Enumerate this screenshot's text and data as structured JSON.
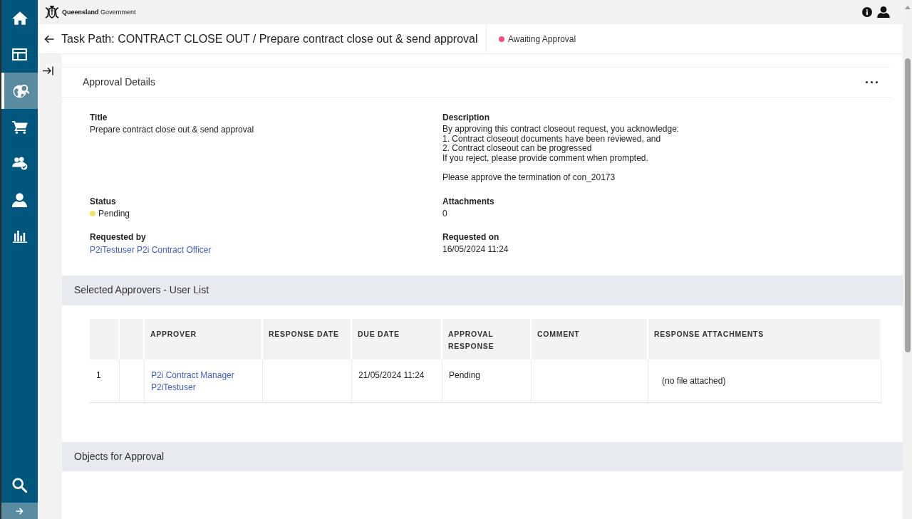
{
  "header": {
    "logo": "**Queensland** Government"
  },
  "sidebar": {
    "items": [
      {
        "selected": false
      },
      {
        "selected": false
      },
      {
        "selected": true
      },
      {
        "selected": false
      },
      {
        "selected": false
      },
      {
        "selected": false
      },
      {
        "selected": false
      }
    ]
  },
  "page_header": {
    "title": "Task Path: CONTRACT CLOSE OUT / Prepare contract close out & send approval",
    "status": {
      "label": "Awaiting Approval",
      "color": "#ee4f88"
    }
  },
  "approval_details": {
    "title": "Approval Details",
    "fields": [
      {
        "kind": "text",
        "label": "Title",
        "value": "Prepare contract close out & send approval"
      },
      {
        "kind": "paragraphs",
        "label": "Description",
        "paragraphs": [
          "By approving this contract closeout request, you acknowledge:\n1. Contract closeout documents have been reviewed, and\n2. Contract closeout can be progressed\nIf you reject, please provide comment when prompted.",
          "Please approve the termination of con_20173"
        ]
      },
      {
        "kind": "status",
        "label": "Status",
        "value": "Pending",
        "color": "#f3e36a"
      },
      {
        "kind": "text",
        "label": "Attachments",
        "value": "0"
      },
      {
        "kind": "link",
        "label": "Requested by",
        "value": "P2iTestuser P2i Contract Officer"
      },
      {
        "kind": "text",
        "label": "Requested on",
        "value": "16/05/2024 11:24"
      }
    ]
  },
  "approvers": {
    "title": "Selected Approvers - User List",
    "table": {
      "columns": [
        {
          "kind": "empty"
        },
        {
          "kind": "empty"
        },
        {
          "kind": "label",
          "label": "APPROVER"
        },
        {
          "kind": "label",
          "label": "RESPONSE DATE"
        },
        {
          "kind": "label",
          "label": "DUE DATE"
        },
        {
          "kind": "label",
          "label": "APPROVAL RESPONSE"
        },
        {
          "kind": "label",
          "label": "COMMENT"
        },
        {
          "kind": "label",
          "label": "RESPONSE ATTACHMENTS"
        }
      ],
      "rows": [
        {
          "cells": [
            {
              "kind": "text",
              "text": "1"
            },
            {
              "kind": "empty"
            },
            {
              "kind": "link",
              "text": "P2i Contract Manager P2iTestuser"
            },
            {
              "kind": "empty"
            },
            {
              "kind": "text",
              "text": "21/05/2024 11:24"
            },
            {
              "kind": "text",
              "text": "Pending"
            },
            {
              "kind": "empty"
            },
            {
              "kind": "attachment",
              "text": "(no file attached)"
            }
          ]
        }
      ]
    }
  },
  "objects_for_approval": {
    "title": "Objects for Approval"
  }
}
